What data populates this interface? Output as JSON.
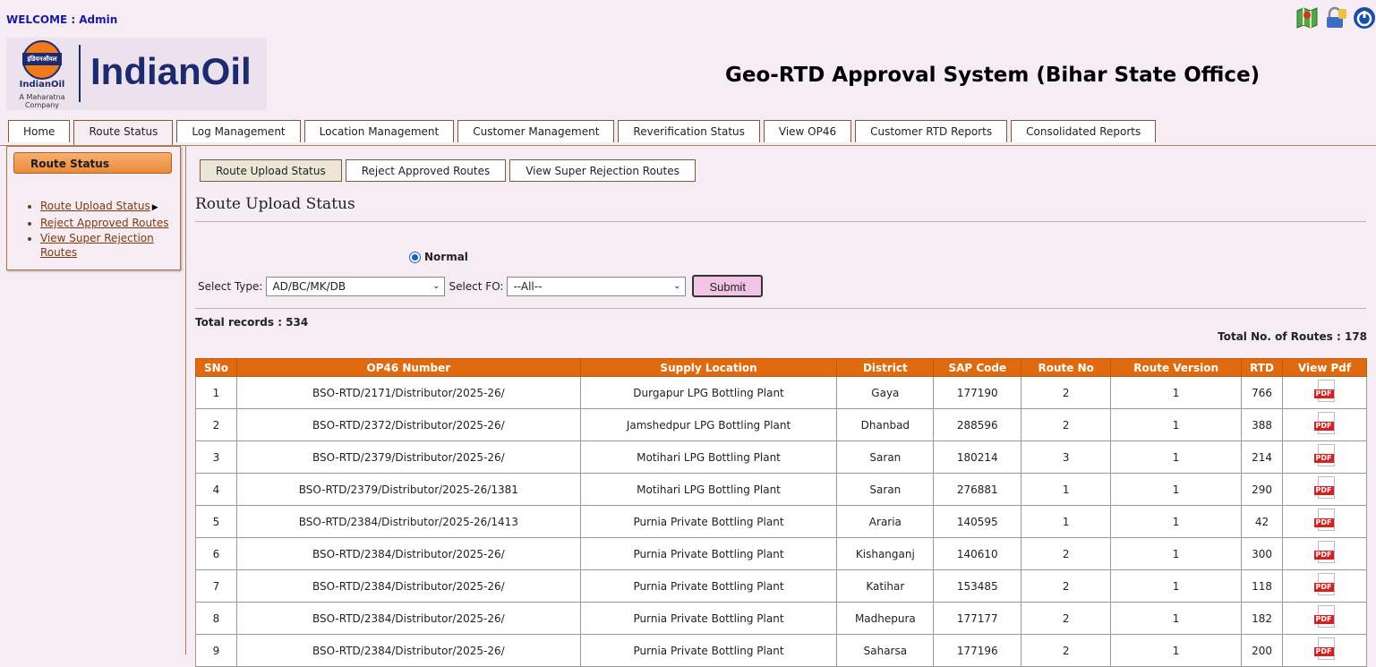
{
  "header": {
    "welcome_label": "WELCOME :",
    "user": "Admin",
    "brand": "IndianOil",
    "logo_band": "इंडियनऑयल",
    "logo_sub": "IndianOil",
    "logo_tagline": "A Maharatna Company",
    "system_title": "Geo-RTD Approval System (Bihar State Office)",
    "icons": [
      "map-icon",
      "lock-icon",
      "power-icon"
    ]
  },
  "main_tabs": [
    "Home",
    "Route Status",
    "Log Management",
    "Location Management",
    "Customer Management",
    "Reverification Status",
    "View OP46",
    "Customer RTD Reports",
    "Consolidated Reports"
  ],
  "sidebar": {
    "heading": "Route Status",
    "items": [
      "Route Upload Status",
      "Reject Approved Routes",
      "View Super Rejection Routes"
    ]
  },
  "sub_tabs": [
    "Route Upload Status",
    "Reject Approved Routes",
    "View Super Rejection Routes"
  ],
  "page": {
    "title": "Route Upload Status",
    "radio_label": "Normal",
    "type_label": "Select Type:",
    "type_value": "AD/BC/MK/DB",
    "fo_label": "Select FO:",
    "fo_value": "--All--",
    "submit_label": "Submit",
    "total_records": "Total records : 534",
    "total_routes": "Total No. of Routes : 178"
  },
  "table": {
    "headers": [
      "SNo",
      "OP46 Number",
      "Supply Location",
      "District",
      "SAP Code",
      "Route No",
      "Route Version",
      "RTD",
      "View Pdf"
    ],
    "rows": [
      [
        "1",
        "BSO-RTD/2171/Distributor/2025-26/",
        "Durgapur LPG Bottling Plant",
        "Gaya",
        "177190",
        "2",
        "1",
        "766"
      ],
      [
        "2",
        "BSO-RTD/2372/Distributor/2025-26/",
        "Jamshedpur LPG Bottling Plant",
        "Dhanbad",
        "288596",
        "2",
        "1",
        "388"
      ],
      [
        "3",
        "BSO-RTD/2379/Distributor/2025-26/",
        "Motihari LPG Bottling Plant",
        "Saran",
        "180214",
        "3",
        "1",
        "214"
      ],
      [
        "4",
        "BSO-RTD/2379/Distributor/2025-26/1381",
        "Motihari LPG Bottling Plant",
        "Saran",
        "276881",
        "1",
        "1",
        "290"
      ],
      [
        "5",
        "BSO-RTD/2384/Distributor/2025-26/1413",
        "Purnia Private Bottling Plant",
        "Araria",
        "140595",
        "1",
        "1",
        "42"
      ],
      [
        "6",
        "BSO-RTD/2384/Distributor/2025-26/",
        "Purnia Private Bottling Plant",
        "Kishanganj",
        "140610",
        "2",
        "1",
        "300"
      ],
      [
        "7",
        "BSO-RTD/2384/Distributor/2025-26/",
        "Purnia Private Bottling Plant",
        "Katihar",
        "153485",
        "2",
        "1",
        "118"
      ],
      [
        "8",
        "BSO-RTD/2384/Distributor/2025-26/",
        "Purnia Private Bottling Plant",
        "Madhepura",
        "177177",
        "2",
        "1",
        "182"
      ],
      [
        "9",
        "BSO-RTD/2384/Distributor/2025-26/",
        "Purnia Private Bottling Plant",
        "Saharsa",
        "177196",
        "2",
        "1",
        "200"
      ]
    ],
    "pdf_label": "PDF"
  }
}
